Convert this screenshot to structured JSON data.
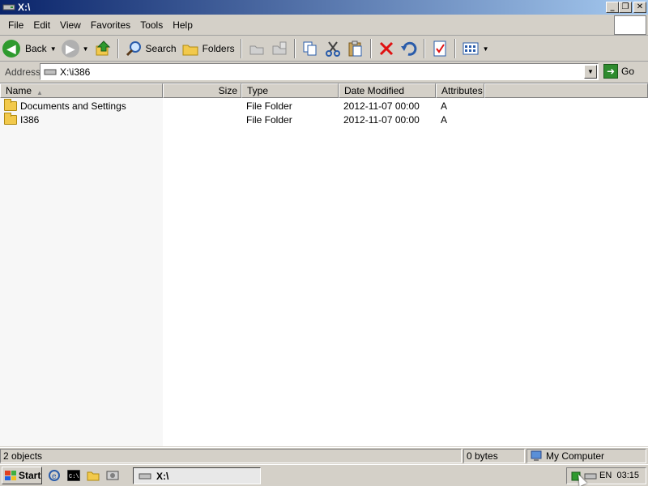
{
  "window": {
    "title": "X:\\",
    "controls": {
      "minimize": "_",
      "maximize": "❐",
      "close": "✕"
    }
  },
  "menu": {
    "items": [
      "File",
      "Edit",
      "View",
      "Favorites",
      "Tools",
      "Help"
    ]
  },
  "toolbar": {
    "back_label": "Back",
    "search_label": "Search",
    "folders_label": "Folders",
    "icons": [
      "back-icon",
      "forward-icon",
      "up-icon",
      "search-icon",
      "folders-icon",
      "move-to-icon",
      "copy-to-icon",
      "copy-icon",
      "cut-icon",
      "paste-icon",
      "delete-icon",
      "undo-icon",
      "properties-icon",
      "views-icon"
    ]
  },
  "address": {
    "label": "Address",
    "value": "X:\\i386",
    "go_label": "Go"
  },
  "columns": {
    "name": "Name",
    "size": "Size",
    "type": "Type",
    "date": "Date Modified",
    "attributes": "Attributes"
  },
  "files": [
    {
      "name": "Documents and Settings",
      "size": "",
      "type": "File Folder",
      "date": "2012-11-07 00:00",
      "attributes": "A"
    },
    {
      "name": "I386",
      "size": "",
      "type": "File Folder",
      "date": "2012-11-07 00:00",
      "attributes": "A"
    }
  ],
  "status": {
    "objects": "2 objects",
    "size": "0 bytes",
    "location": "My Computer"
  },
  "taskbar": {
    "start_label": "Start",
    "window_button": "X:\\",
    "language": "EN",
    "clock": "03:15"
  },
  "colors": {
    "title_gradient_start": "#0a246a",
    "title_gradient_end": "#a6caf0",
    "chrome": "#d4d0c8"
  }
}
